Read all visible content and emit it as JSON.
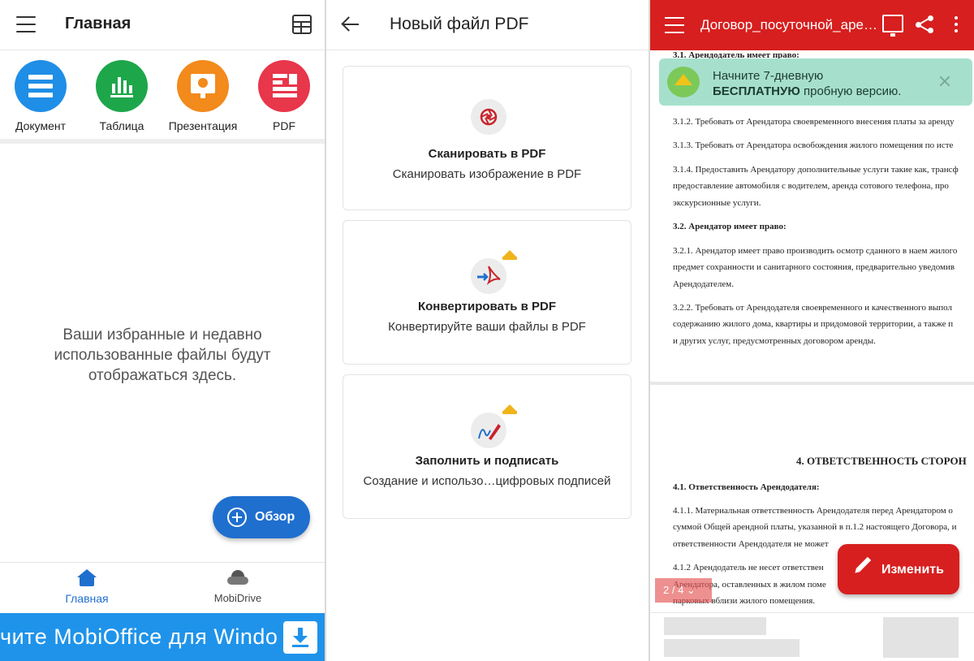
{
  "home": {
    "title": "Главная",
    "apps": [
      {
        "label": "Документ",
        "icon": "document-icon",
        "color": "#1f8ee6"
      },
      {
        "label": "Таблица",
        "icon": "spreadsheet-icon",
        "color": "#1ea64a"
      },
      {
        "label": "Презентация",
        "icon": "presentation-icon",
        "color": "#f28a1c"
      },
      {
        "label": "PDF",
        "icon": "pdf-icon",
        "color": "#e8364b"
      }
    ],
    "empty_message": "Ваши избранные и недавно использованные файлы будут отображаться здесь.",
    "browse_button": "Обзор",
    "nav": {
      "home": "Главная",
      "drive": "MobiDrive"
    },
    "promo_text": "чите MobiOffice для Windo",
    "accent_color": "#1f6fce"
  },
  "new_pdf": {
    "title": "Новый файл PDF",
    "options": [
      {
        "title": "Сканировать в PDF",
        "subtitle": "Сканировать изображение в PDF",
        "icon": "scan-icon",
        "premium": false
      },
      {
        "title": "Конвертировать в PDF",
        "subtitle": "Конвертируйте ваши файлы в PDF",
        "icon": "convert-icon",
        "premium": true
      },
      {
        "title": "Заполнить и подписать",
        "subtitle": "Создание и использо…цифровых подписей",
        "icon": "sign-icon",
        "premium": true
      }
    ]
  },
  "viewer": {
    "title": "Договор_посуточной_аре…",
    "header_color": "#d71f1f",
    "toast": {
      "line1": "Начните 7-дневную",
      "line2_bold": "БЕСПЛАТНУЮ",
      "line2_rest": " пробную версию."
    },
    "doc_lines": [
      "3.1. Арендодатель имеет право:",
      "3.1.2. Требовать от Арендатора своевременного внесения платы за аренду",
      "3.1.3. Требовать от Арендатора освобождения жилого помещения по исте",
      "3.1.4. Предоставить Арендатору дополнительные услуги такие как, трансф",
      "предоставление автомобиля с водителем, аренда сотового телефона, про",
      "экскурсионные услуги.",
      "3.2. Арендатор имеет право:",
      "3.2.1. Арендатор имеет право производить осмотр сданного в наем жилого",
      "предмет сохранности и санитарного состояния, предварительно уведомив",
      "Арендодателем.",
      "3.2.2. Требовать от Арендодателя своевременного и качественного выпол",
      "содержанию жилого дома, квартиры и придомовой территории, а также п",
      "и других услуг, предусмотренных договором аренды.",
      "4. ОТВЕТСТВЕННОСТЬ СТОРОН",
      "4.1. Ответственность Арендодателя:",
      "4.1.1. Материальная ответственность Арендодателя перед Арендатором о",
      "суммой Общей арендной платы, указанной в п.1.2 настоящего Договора, и",
      "ответственности Арендодателя не может",
      "4.1.2 Арендодатель не несет ответствен",
      "Арендатора, оставленных в жилом поме",
      "парковых вблизи жилого помещения."
    ],
    "page_indicator": "2 / 4 ⌄",
    "edit_button": "Изменить"
  }
}
